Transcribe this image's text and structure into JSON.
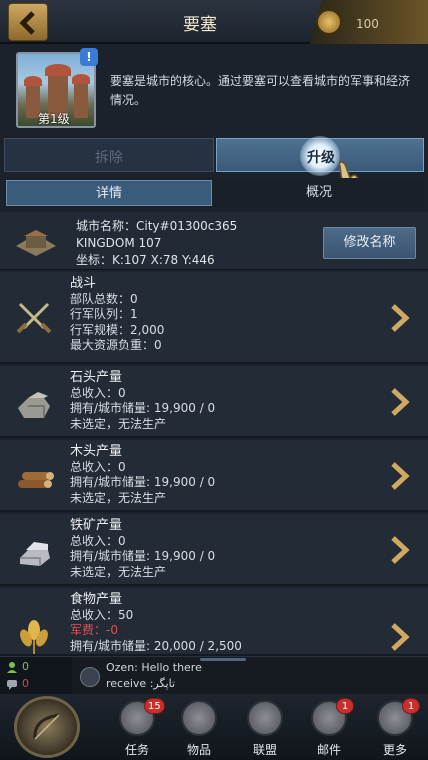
{
  "header": {
    "title": "要塞",
    "coin_value": "100"
  },
  "fortress": {
    "level_label": "第1级",
    "info_badge": "!",
    "description": "要塞是城市的核心。通过要塞可以查看城市的军事和经济情况。"
  },
  "actions": {
    "demolish_label": "拆除",
    "upgrade_label": "升级"
  },
  "tabs": [
    {
      "label": "详情",
      "active": true
    },
    {
      "label": "概况",
      "active": false
    }
  ],
  "city": {
    "name_line": "城市名称：City#01300c365",
    "kingdom_line": "KINGDOM 107",
    "coords_line": "坐标：K:107 X:78 Y:446",
    "rename_label": "修改名称"
  },
  "sections": {
    "battle": {
      "title": "战斗",
      "lines": [
        "部队总数：0",
        "行军队列：1",
        "行军规模：2,000",
        "最大资源负重：0"
      ]
    },
    "stone": {
      "title": "石头产量",
      "lines": [
        "总收入：0",
        "拥有/城市储量: 19,900 / 0",
        "未选定，无法生产"
      ]
    },
    "wood": {
      "title": "木头产量",
      "lines": [
        "总收入：0",
        "拥有/城市储量: 19,900 / 0",
        "未选定，无法生产"
      ]
    },
    "iron": {
      "title": "铁矿产量",
      "lines": [
        "总收入：0",
        "拥有/城市储量: 19,900 / 0",
        "未选定，无法生产"
      ]
    },
    "food": {
      "title": "食物产量",
      "lines": [
        "总收入：50",
        "军费：-0",
        "拥有/城市储量: 20,000 / 2,500"
      ]
    }
  },
  "chat": {
    "count_green": "0",
    "count_red": "0",
    "line1": "Ozen: Hello there",
    "line2": "receive :تاپگر"
  },
  "nav": [
    {
      "label": "任务",
      "badge": "15",
      "icon": "quest-icon"
    },
    {
      "label": "物品",
      "badge": "",
      "icon": "items-icon"
    },
    {
      "label": "联盟",
      "badge": "",
      "icon": "alliance-icon"
    },
    {
      "label": "邮件",
      "badge": "1",
      "icon": "mail-icon"
    },
    {
      "label": "更多",
      "badge": "1",
      "icon": "more-icon"
    }
  ],
  "colors": {
    "accent_gold": "#cfa862",
    "panel": "#232b36",
    "tab_active": "#3b5b7a",
    "badge_red": "#c8302b"
  }
}
